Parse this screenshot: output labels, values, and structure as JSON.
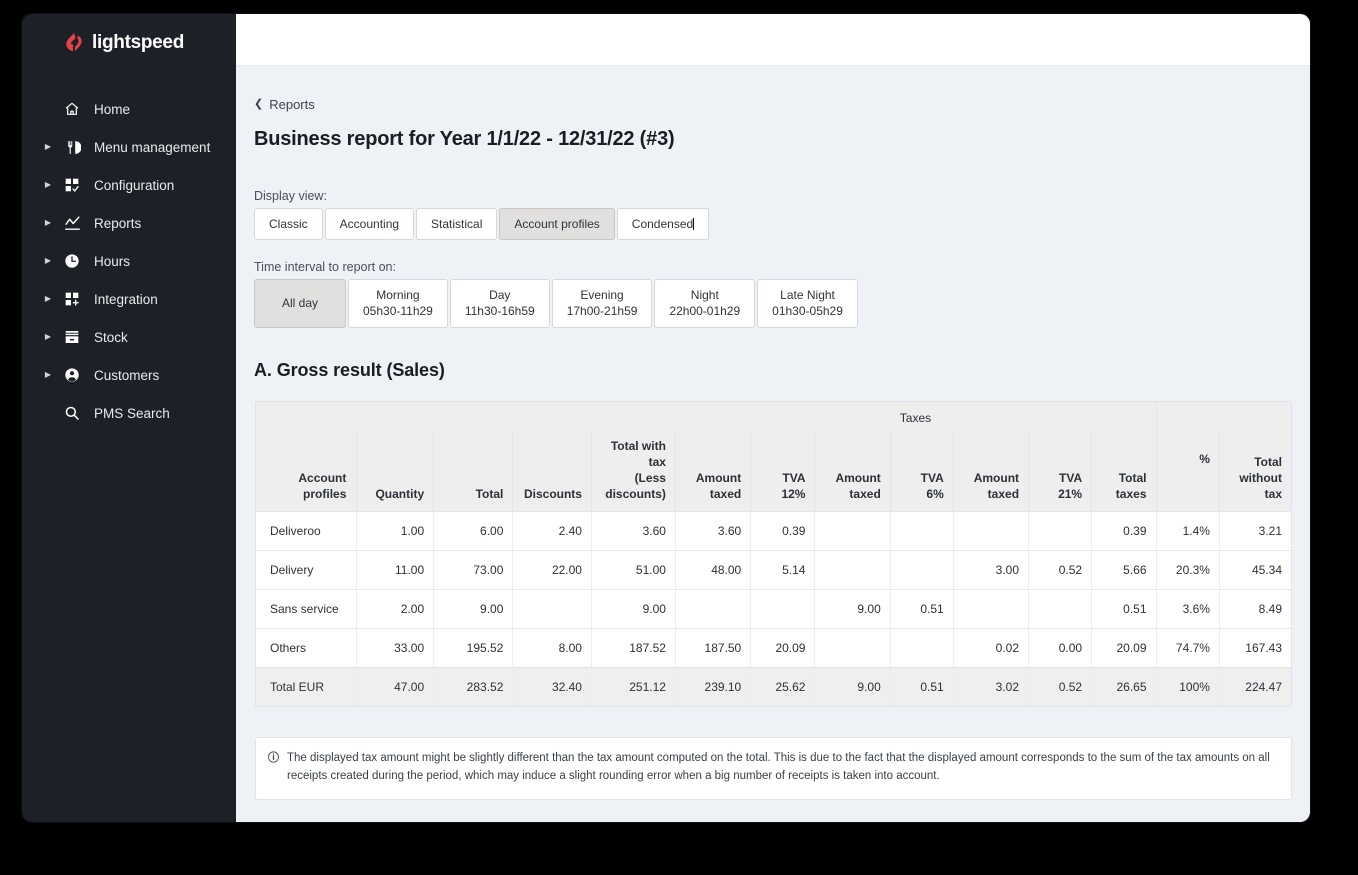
{
  "brand": {
    "name": "lightspeed",
    "logo_color": "#e8414a",
    "sidebar_bg": "#1d2026"
  },
  "sidebar": {
    "items": [
      {
        "label": "Home",
        "icon": "home-icon",
        "expandable": false
      },
      {
        "label": "Menu management",
        "icon": "menu-icon",
        "expandable": true
      },
      {
        "label": "Configuration",
        "icon": "config-icon",
        "expandable": true
      },
      {
        "label": "Reports",
        "icon": "chart-line-icon",
        "expandable": true
      },
      {
        "label": "Hours",
        "icon": "clock-icon",
        "expandable": true
      },
      {
        "label": "Integration",
        "icon": "integration-icon",
        "expandable": true
      },
      {
        "label": "Stock",
        "icon": "stock-icon",
        "expandable": true
      },
      {
        "label": "Customers",
        "icon": "user-icon",
        "expandable": true
      },
      {
        "label": "PMS Search",
        "icon": "search-icon",
        "expandable": false
      }
    ]
  },
  "breadcrumb": {
    "label": "Reports",
    "icon": "chevron-left-icon"
  },
  "page": {
    "title": "Business report for Year 1/1/22 - 12/31/22 (#3)",
    "section_title": "A. Gross result (Sales)"
  },
  "display_view": {
    "label": "Display view:",
    "options": [
      "Classic",
      "Accounting",
      "Statistical",
      "Account profiles",
      "Condensed"
    ],
    "selected": "Account profiles",
    "focused": "Condensed"
  },
  "time_interval": {
    "label": "Time interval to report on:",
    "options": [
      {
        "name": "All day",
        "range": ""
      },
      {
        "name": "Morning",
        "range": "05h30-11h29"
      },
      {
        "name": "Day",
        "range": "11h30-16h59"
      },
      {
        "name": "Evening",
        "range": "17h00-21h59"
      },
      {
        "name": "Night",
        "range": "22h00-01h29"
      },
      {
        "name": "Late Night",
        "range": "01h30-05h29"
      }
    ],
    "selected": "All day"
  },
  "table": {
    "group_header": "Taxes",
    "columns": [
      "Account profiles",
      "Quantity",
      "Total",
      "Discounts",
      "Total with tax (Less discounts)",
      "Amount taxed",
      "TVA 12%",
      "Amount taxed",
      "TVA 6%",
      "Amount taxed",
      "TVA 21%",
      "Total taxes",
      "%",
      "Total without tax"
    ],
    "columns_display": [
      "Account\nprofiles",
      "Quantity",
      "Total",
      "Discounts",
      "Total with\ntax\n(Less\ndiscounts)",
      "Amount\ntaxed",
      "TVA\n12%",
      "Amount\ntaxed",
      "TVA\n6%",
      "Amount\ntaxed",
      "TVA\n21%",
      "Total\ntaxes",
      "%",
      "Total\nwithout\ntax"
    ],
    "rows": [
      {
        "label": "Deliveroo",
        "cells": [
          "1.00",
          "6.00",
          "2.40",
          "3.60",
          "3.60",
          "0.39",
          "",
          "",
          "",
          "",
          "0.39",
          "1.4%",
          "3.21"
        ],
        "is_total": false
      },
      {
        "label": "Delivery",
        "cells": [
          "11.00",
          "73.00",
          "22.00",
          "51.00",
          "48.00",
          "5.14",
          "",
          "",
          "3.00",
          "0.52",
          "5.66",
          "20.3%",
          "45.34"
        ],
        "is_total": false
      },
      {
        "label": "Sans service",
        "cells": [
          "2.00",
          "9.00",
          "",
          "9.00",
          "",
          "",
          "9.00",
          "0.51",
          "",
          "",
          "0.51",
          "3.6%",
          "8.49"
        ],
        "is_total": false
      },
      {
        "label": "Others",
        "cells": [
          "33.00",
          "195.52",
          "8.00",
          "187.52",
          "187.50",
          "20.09",
          "",
          "",
          "0.02",
          "0.00",
          "20.09",
          "74.7%",
          "167.43"
        ],
        "is_total": false
      },
      {
        "label": "Total EUR",
        "cells": [
          "47.00",
          "283.52",
          "32.40",
          "251.12",
          "239.10",
          "25.62",
          "9.00",
          "0.51",
          "3.02",
          "0.52",
          "26.65",
          "100%",
          "224.47"
        ],
        "is_total": true
      }
    ]
  },
  "note": {
    "icon": "info-icon",
    "text": "The displayed tax amount might be slightly different than the tax amount computed on the total. This is due to the fact that the displayed amount corresponds to the sum of the tax amounts on all receipts created during the period, which may induce a slight rounding error when a big number of receipts is taken into account."
  }
}
